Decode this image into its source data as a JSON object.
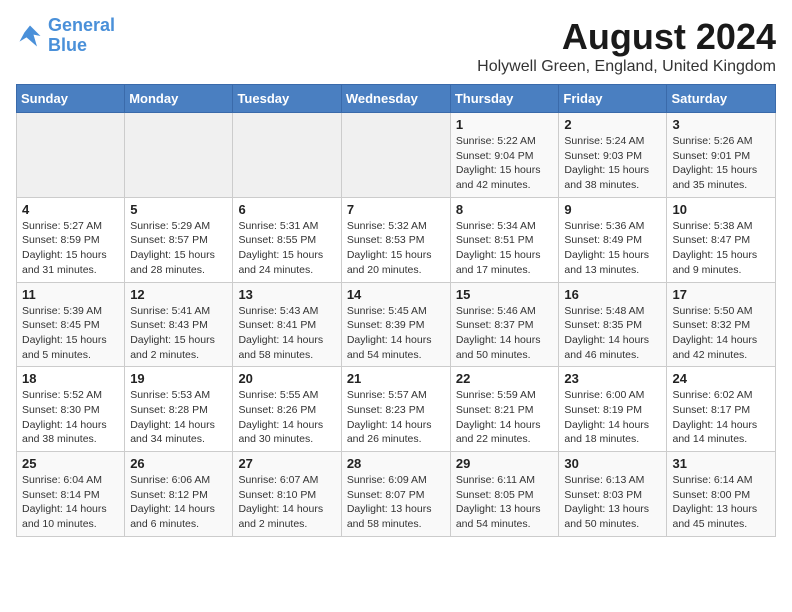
{
  "logo": {
    "line1": "General",
    "line2": "Blue"
  },
  "title": "August 2024",
  "subtitle": "Holywell Green, England, United Kingdom",
  "days_of_week": [
    "Sunday",
    "Monday",
    "Tuesday",
    "Wednesday",
    "Thursday",
    "Friday",
    "Saturday"
  ],
  "weeks": [
    [
      {
        "day": "",
        "info": ""
      },
      {
        "day": "",
        "info": ""
      },
      {
        "day": "",
        "info": ""
      },
      {
        "day": "",
        "info": ""
      },
      {
        "day": "1",
        "info": "Sunrise: 5:22 AM\nSunset: 9:04 PM\nDaylight: 15 hours\nand 42 minutes."
      },
      {
        "day": "2",
        "info": "Sunrise: 5:24 AM\nSunset: 9:03 PM\nDaylight: 15 hours\nand 38 minutes."
      },
      {
        "day": "3",
        "info": "Sunrise: 5:26 AM\nSunset: 9:01 PM\nDaylight: 15 hours\nand 35 minutes."
      }
    ],
    [
      {
        "day": "4",
        "info": "Sunrise: 5:27 AM\nSunset: 8:59 PM\nDaylight: 15 hours\nand 31 minutes."
      },
      {
        "day": "5",
        "info": "Sunrise: 5:29 AM\nSunset: 8:57 PM\nDaylight: 15 hours\nand 28 minutes."
      },
      {
        "day": "6",
        "info": "Sunrise: 5:31 AM\nSunset: 8:55 PM\nDaylight: 15 hours\nand 24 minutes."
      },
      {
        "day": "7",
        "info": "Sunrise: 5:32 AM\nSunset: 8:53 PM\nDaylight: 15 hours\nand 20 minutes."
      },
      {
        "day": "8",
        "info": "Sunrise: 5:34 AM\nSunset: 8:51 PM\nDaylight: 15 hours\nand 17 minutes."
      },
      {
        "day": "9",
        "info": "Sunrise: 5:36 AM\nSunset: 8:49 PM\nDaylight: 15 hours\nand 13 minutes."
      },
      {
        "day": "10",
        "info": "Sunrise: 5:38 AM\nSunset: 8:47 PM\nDaylight: 15 hours\nand 9 minutes."
      }
    ],
    [
      {
        "day": "11",
        "info": "Sunrise: 5:39 AM\nSunset: 8:45 PM\nDaylight: 15 hours\nand 5 minutes."
      },
      {
        "day": "12",
        "info": "Sunrise: 5:41 AM\nSunset: 8:43 PM\nDaylight: 15 hours\nand 2 minutes."
      },
      {
        "day": "13",
        "info": "Sunrise: 5:43 AM\nSunset: 8:41 PM\nDaylight: 14 hours\nand 58 minutes."
      },
      {
        "day": "14",
        "info": "Sunrise: 5:45 AM\nSunset: 8:39 PM\nDaylight: 14 hours\nand 54 minutes."
      },
      {
        "day": "15",
        "info": "Sunrise: 5:46 AM\nSunset: 8:37 PM\nDaylight: 14 hours\nand 50 minutes."
      },
      {
        "day": "16",
        "info": "Sunrise: 5:48 AM\nSunset: 8:35 PM\nDaylight: 14 hours\nand 46 minutes."
      },
      {
        "day": "17",
        "info": "Sunrise: 5:50 AM\nSunset: 8:32 PM\nDaylight: 14 hours\nand 42 minutes."
      }
    ],
    [
      {
        "day": "18",
        "info": "Sunrise: 5:52 AM\nSunset: 8:30 PM\nDaylight: 14 hours\nand 38 minutes."
      },
      {
        "day": "19",
        "info": "Sunrise: 5:53 AM\nSunset: 8:28 PM\nDaylight: 14 hours\nand 34 minutes."
      },
      {
        "day": "20",
        "info": "Sunrise: 5:55 AM\nSunset: 8:26 PM\nDaylight: 14 hours\nand 30 minutes."
      },
      {
        "day": "21",
        "info": "Sunrise: 5:57 AM\nSunset: 8:23 PM\nDaylight: 14 hours\nand 26 minutes."
      },
      {
        "day": "22",
        "info": "Sunrise: 5:59 AM\nSunset: 8:21 PM\nDaylight: 14 hours\nand 22 minutes."
      },
      {
        "day": "23",
        "info": "Sunrise: 6:00 AM\nSunset: 8:19 PM\nDaylight: 14 hours\nand 18 minutes."
      },
      {
        "day": "24",
        "info": "Sunrise: 6:02 AM\nSunset: 8:17 PM\nDaylight: 14 hours\nand 14 minutes."
      }
    ],
    [
      {
        "day": "25",
        "info": "Sunrise: 6:04 AM\nSunset: 8:14 PM\nDaylight: 14 hours\nand 10 minutes."
      },
      {
        "day": "26",
        "info": "Sunrise: 6:06 AM\nSunset: 8:12 PM\nDaylight: 14 hours\nand 6 minutes."
      },
      {
        "day": "27",
        "info": "Sunrise: 6:07 AM\nSunset: 8:10 PM\nDaylight: 14 hours\nand 2 minutes."
      },
      {
        "day": "28",
        "info": "Sunrise: 6:09 AM\nSunset: 8:07 PM\nDaylight: 13 hours\nand 58 minutes."
      },
      {
        "day": "29",
        "info": "Sunrise: 6:11 AM\nSunset: 8:05 PM\nDaylight: 13 hours\nand 54 minutes."
      },
      {
        "day": "30",
        "info": "Sunrise: 6:13 AM\nSunset: 8:03 PM\nDaylight: 13 hours\nand 50 minutes."
      },
      {
        "day": "31",
        "info": "Sunrise: 6:14 AM\nSunset: 8:00 PM\nDaylight: 13 hours\nand 45 minutes."
      }
    ]
  ]
}
